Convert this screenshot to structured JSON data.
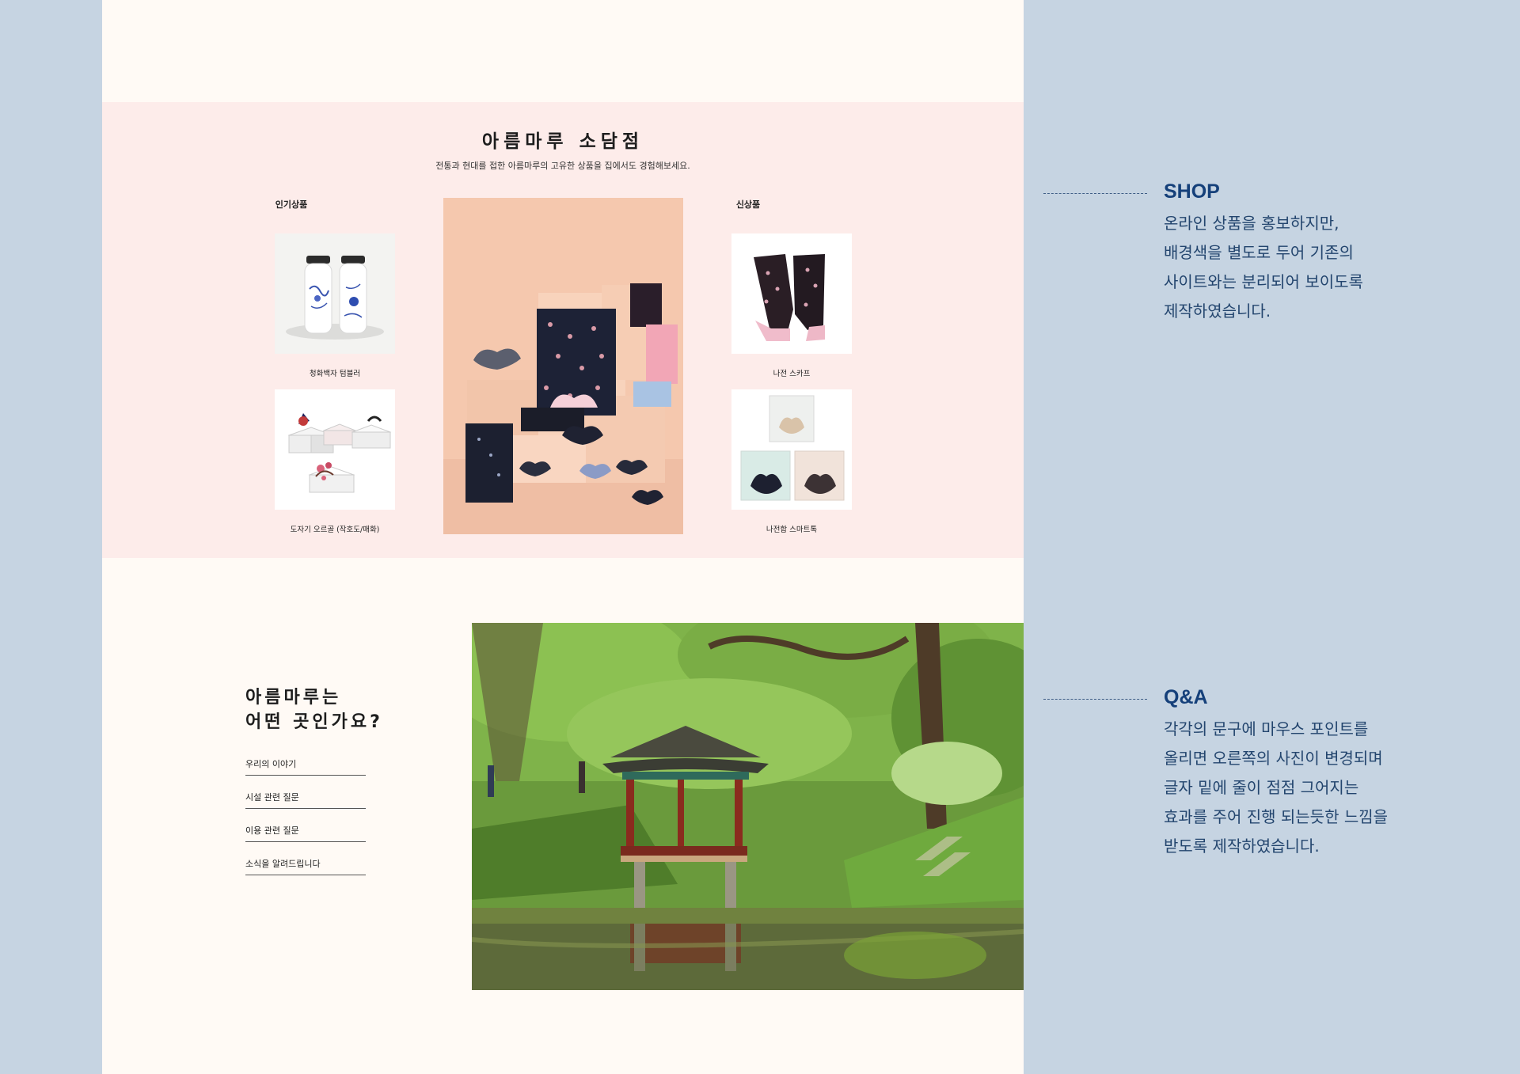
{
  "shop": {
    "title": "아름마루 소담점",
    "subtitle": "전통과 현대를 접한 아름마루의 고유한 상품을 집에서도 경험해보세요.",
    "popular_heading": "인기상품",
    "new_heading": "신상품",
    "popular_items": [
      {
        "name": "청화백자 텀블러"
      },
      {
        "name": "도자기 오르골 (작호도/매화)"
      }
    ],
    "new_items": [
      {
        "name": "나전 스카프"
      },
      {
        "name": "나전합 스마트톡"
      }
    ]
  },
  "qa": {
    "title_line1": "아름마루는",
    "title_line2": "어떤 곳인가요?",
    "items": [
      {
        "label": "우리의 이야기"
      },
      {
        "label": "시설 관련 질문"
      },
      {
        "label": "이용 관련 질문"
      },
      {
        "label": "소식을 알려드립니다"
      }
    ]
  },
  "notes": [
    {
      "title": "SHOP",
      "lines": [
        "온라인 상품을 홍보하지만,",
        "배경색을 별도로 두어 기존의",
        "사이트와는 분리되어 보이도록",
        "제작하였습니다."
      ]
    },
    {
      "title": "Q&A",
      "lines": [
        "각각의 문구에 마우스 포인트를",
        "올리면 오른쪽의 사진이 변경되며",
        "글자 밑에 줄이 점점 그어지는",
        "효과를 주어 진행 되는듯한 느낌을",
        "받도록 제작하였습니다."
      ]
    }
  ],
  "colors": {
    "outer_background": "#c6d4e2",
    "page_background": "#fffaf5",
    "shop_background": "#fdecea",
    "accent_navy": "#15407a"
  }
}
